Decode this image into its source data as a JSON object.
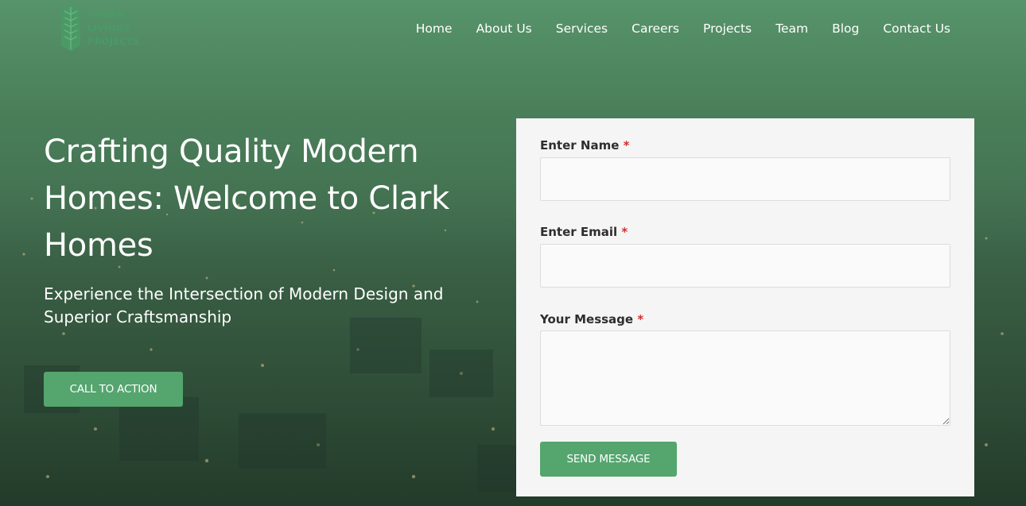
{
  "header": {
    "logo_lines": [
      "URBAN",
      "LIVINGS",
      "PROJECTS"
    ],
    "nav": [
      {
        "label": "Home"
      },
      {
        "label": "About Us"
      },
      {
        "label": "Services"
      },
      {
        "label": "Careers"
      },
      {
        "label": "Projects"
      },
      {
        "label": "Team"
      },
      {
        "label": "Blog"
      },
      {
        "label": "Contact Us"
      }
    ]
  },
  "hero": {
    "title": "Crafting Quality Modern Homes: Welcome to Clark Homes",
    "subtitle": "Experience the Intersection of Modern Design and Superior Craftsmanship",
    "cta_label": "CALL TO ACTION"
  },
  "form": {
    "name_label": "Enter Name",
    "email_label": "Enter Email",
    "message_label": "Your Message",
    "required_mark": "*",
    "name_value": "",
    "email_value": "",
    "message_value": "",
    "submit_label": "SEND MESSAGE"
  },
  "colors": {
    "accent": "#55a56e",
    "required": "#d0302f",
    "logo": "#4a9a66"
  },
  "icons": {
    "logo_mark": "leaf-logo-icon"
  }
}
